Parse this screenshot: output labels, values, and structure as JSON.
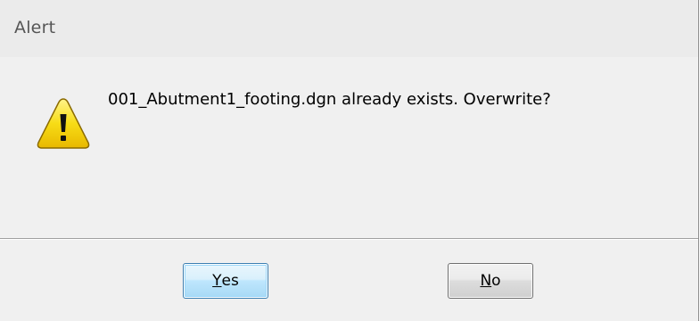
{
  "window": {
    "title": "Alert"
  },
  "message": {
    "text": "001_Abutment1_footing.dgn already exists. Overwrite?",
    "icon": "warning-icon"
  },
  "buttons": {
    "yes": {
      "mnemonic": "Y",
      "rest": "es"
    },
    "no": {
      "mnemonic": "N",
      "rest": "o"
    }
  },
  "colors": {
    "dialog_bg": "#f0f0f0",
    "title_bg": "#ebebeb",
    "default_button_border": "#3c7fb1",
    "warning_fill": "#f5d400"
  }
}
